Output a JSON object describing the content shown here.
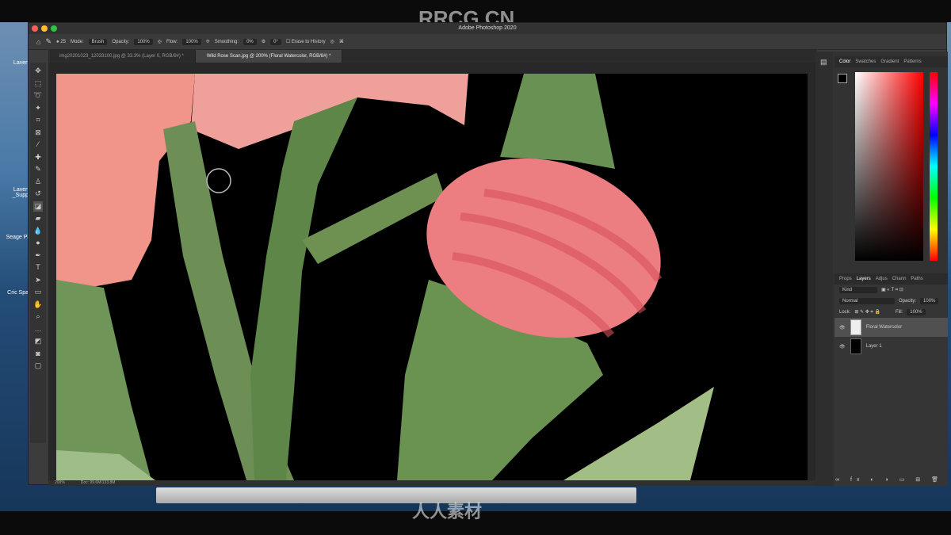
{
  "watermark_top": "RRCG.CN",
  "watermark_bottom": "人人素材",
  "desktop": {
    "labels": [
      "Laven",
      "Laven _Supp",
      "Seage Pl",
      "Cric Spa"
    ]
  },
  "app": {
    "title": "Adobe Photoshop 2020"
  },
  "options": {
    "mode_label": "Mode:",
    "mode": "Brush",
    "opacity_label": "Opacity:",
    "opacity": "100%",
    "flow_label": "Flow:",
    "flow": "100%",
    "smoothing_label": "Smoothing:",
    "smoothing": "0%",
    "angle": "0°",
    "brush_size": "25",
    "erase_history": "Erase to History"
  },
  "tabs": [
    {
      "label": "img20201023_12033100.jpg @ 33.3% (Layer 0, RGB/8#) *"
    },
    {
      "label": "Wild Rose Scan.jpg @ 200% (Floral Watercolor, RGB/8#) *"
    }
  ],
  "status": {
    "zoom": "200%",
    "doc": "Doc: 99.6M/133.8M"
  },
  "color_panel": {
    "tabs": [
      "Color",
      "Swatches",
      "Gradient",
      "Patterns"
    ],
    "hue": "#ff0000"
  },
  "layers_panel": {
    "tabs": [
      "Props",
      "Layers",
      "Adjus",
      "Chann",
      "Paths"
    ],
    "filter": "Kind",
    "blend": "Normal",
    "opacity_label": "Opacity:",
    "opacity": "100%",
    "lock_label": "Lock:",
    "fill_label": "Fill:",
    "fill": "100%",
    "layers": [
      {
        "name": "Floral Watercolor",
        "selected": true
      },
      {
        "name": "Layer 1",
        "selected": false
      }
    ]
  }
}
